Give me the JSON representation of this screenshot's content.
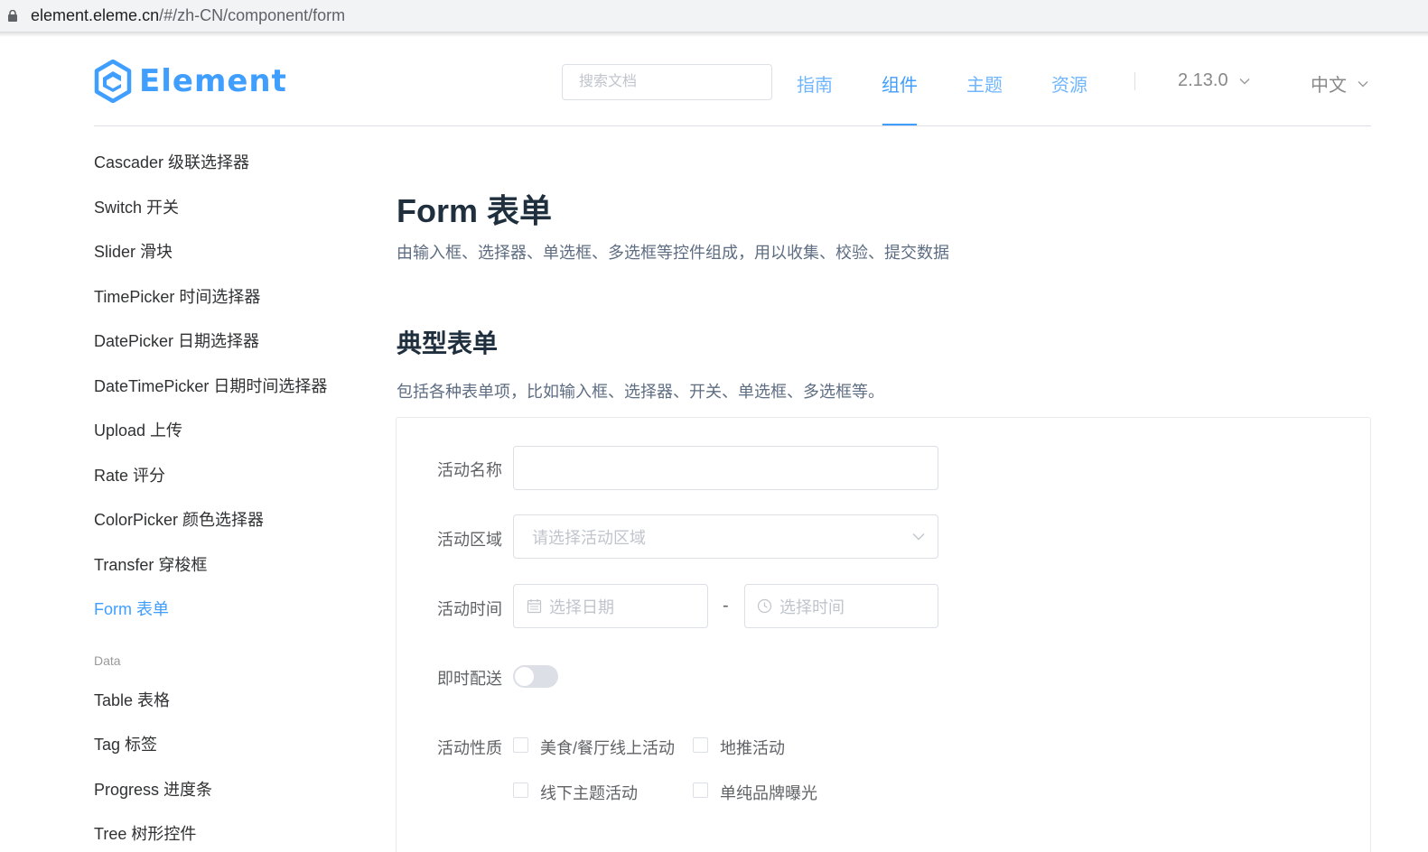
{
  "browser": {
    "url_host": "element.eleme.cn",
    "url_rest": "/#/zh-CN/component/form"
  },
  "header": {
    "logo_text": "Element",
    "search_placeholder": "搜索文档",
    "nav": [
      "指南",
      "组件",
      "主题",
      "资源"
    ],
    "active_nav": "组件",
    "version": "2.13.0",
    "language": "中文"
  },
  "sidebar": {
    "items": [
      "Cascader 级联选择器",
      "Switch 开关",
      "Slider 滑块",
      "TimePicker 时间选择器",
      "DatePicker 日期选择器",
      "DateTimePicker 日期时间选择器",
      "Upload 上传",
      "Rate 评分",
      "ColorPicker 颜色选择器",
      "Transfer 穿梭框",
      "Form 表单"
    ],
    "active_item": "Form 表单",
    "group_label": "Data",
    "group_items": [
      "Table 表格",
      "Tag 标签",
      "Progress 进度条",
      "Tree 树形控件"
    ]
  },
  "main": {
    "title": "Form 表单",
    "description": "由输入框、选择器、单选框、多选框等控件组成，用以收集、校验、提交数据",
    "section_title": "典型表单",
    "section_description": "包括各种表单项，比如输入框、选择器、开关、单选框、多选框等。"
  },
  "form": {
    "name_label": "活动名称",
    "name_value": "",
    "region_label": "活动区域",
    "region_placeholder": "请选择活动区域",
    "time_label": "活动时间",
    "date_placeholder": "选择日期",
    "time_separator": "-",
    "time_placeholder": "选择时间",
    "delivery_label": "即时配送",
    "delivery_on": false,
    "type_label": "活动性质",
    "type_options": [
      "美食/餐厅线上活动",
      "地推活动",
      "线下主题活动",
      "单纯品牌曝光"
    ]
  },
  "colors": {
    "primary": "#409eff",
    "text": "#303133",
    "border": "#dcdfe6",
    "placeholder": "#c0c4cc"
  }
}
